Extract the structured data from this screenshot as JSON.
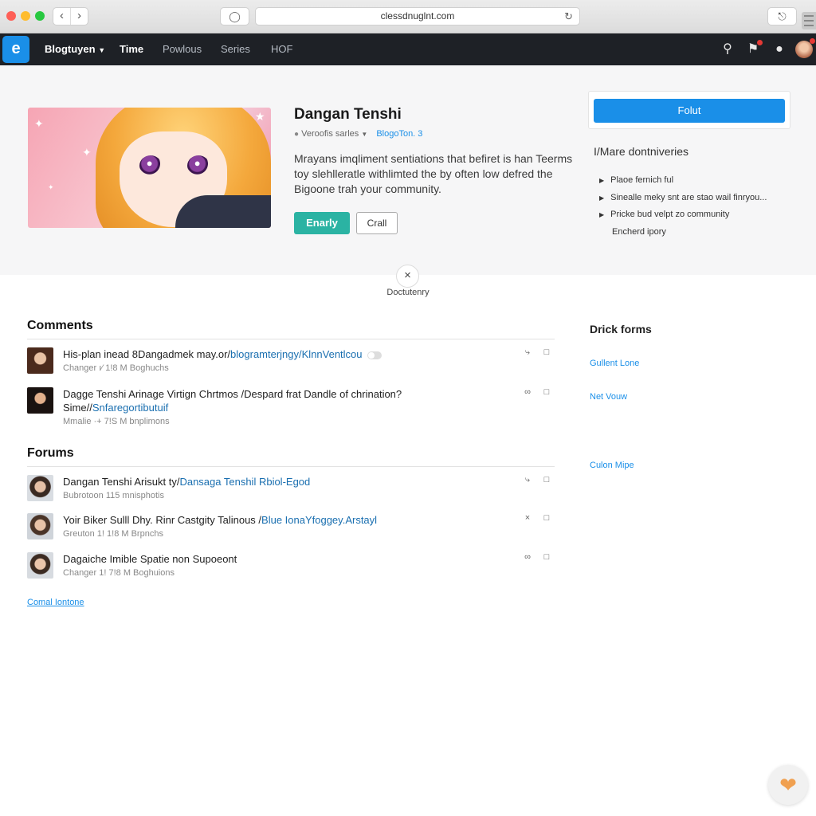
{
  "browser": {
    "url": "clessdnuglnt.com",
    "back_glyph": "‹",
    "forward_glyph": "›"
  },
  "nav": {
    "brand": "Blogtuyen",
    "links": [
      "Time",
      "Powlous",
      "Series",
      "HOF"
    ],
    "icons": [
      "search-icon",
      "flag-icon",
      "notifications-icon",
      "avatar"
    ]
  },
  "hero": {
    "title": "Dangan Tenshi",
    "meta_left": "Veroofis sarles",
    "meta_link": "BlogoTon. 3",
    "description": "Mrayans imqliment sentiations that befiret is han Teerms toy slehlleratle withlimted the by often low defred the Bigoone trah your community.",
    "primary_button": "Enarly",
    "secondary_button": "Crall"
  },
  "sidebar": {
    "follow_button": "Folut",
    "heading": "I/Mare dontniveries",
    "items": [
      "Plaoe fernich ful",
      "Sinealle meky snt are stao wail finryou...",
      "Pricke bud velpt zo community",
      "Encherd ipory"
    ]
  },
  "close": {
    "glyph": "×",
    "label": "Doctutenry"
  },
  "comments": {
    "title": "Comments",
    "items": [
      {
        "text": "His-plan inead 8Dangadmek may.or/",
        "link": "blogramterjngy/KlnnVentlcou",
        "sub": "Changer ı⁄ 1!8 M Boghuchs"
      },
      {
        "text": "Dagge Tenshi Arinage Virtign Chrtmos /Despard frat Dandle of chrination? Sime//",
        "link": "Snfaregortibutuif",
        "sub": "Mmalie ·+ 7!S M bnplimons"
      }
    ]
  },
  "forums": {
    "title": "Forums",
    "items": [
      {
        "text": "Dangan Tenshi Arisukt ty/",
        "link": "Dansaga Tenshil Rbiol-Egod",
        "sub": "Bubrotoon 115 mnisphotis"
      },
      {
        "text": "Yoir Biker Sulll Dhy. Rinr Castgity Talinous /",
        "link": "Blue IonaYfoggey.Arstayl",
        "sub": "Greuton 1! 1!8 M Brpnchs"
      },
      {
        "text": "Dagaiche Imible Spatie non Supoeont",
        "link": "",
        "sub": "Changer 1! 7!8 M Boghuions"
      }
    ]
  },
  "more_link": "Comal Iontone",
  "right": {
    "heading": "Drick forms",
    "links": [
      "Gullent Lone",
      "Net Vouw",
      "Culon Mipe"
    ]
  },
  "colors": {
    "accent_blue": "#1a8fe8",
    "accent_teal": "#2bb3a3",
    "nav_bg": "#1e2126",
    "fab_heart": "#f0a050"
  }
}
